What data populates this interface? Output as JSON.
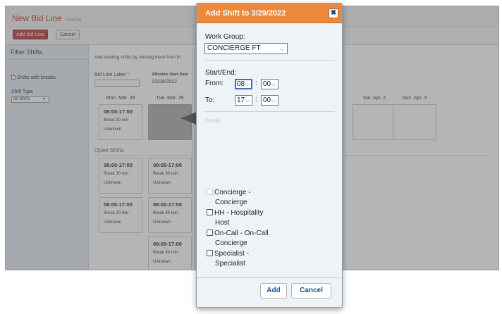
{
  "app": {
    "title": "New Bid Line",
    "subtitle": "Test RS",
    "add_bid_line_label": "Add Bid Line",
    "cancel_label": "Cancel"
  },
  "sidebar": {
    "title": "Filter Shifts",
    "shifts_with_breaks_label": "Shifts with breaks",
    "shift_type_label": "Shift Type",
    "shift_type_value": "All Shifts"
  },
  "main": {
    "intro": "Add existing shifts by clicking them from th",
    "bid_line_label": "Bid Line Label",
    "required_mark": "*",
    "effective_start_label": "Effective Start Date",
    "effective_start_value": "03/28/2022",
    "days": [
      "Mon. Mar. 28",
      "Tue. Mar. 29",
      "Sat. Apr. 2",
      "Sun. Apr. 3"
    ],
    "assigned_card": {
      "time": "08:00-17:00",
      "break": "Break 30 min",
      "status": "Unknown"
    },
    "open_shifts_title": "Open Shifts",
    "open_shifts": [
      {
        "time": "08:00-17:00",
        "break": "Break 30 min",
        "status": "Unknown"
      },
      {
        "time": "08:00-17:00",
        "break": "Break 30 min",
        "status": "Unknown"
      },
      {
        "time": "08:00-17:00",
        "break": "Break 30 min",
        "status": "Unknown"
      },
      {
        "time": "08:00-17:00",
        "break": "Break 30 min",
        "status": "Unknown"
      },
      {
        "time": "08:00-17:00",
        "break": "Break 30 min",
        "status": "Unknown"
      }
    ]
  },
  "dialog": {
    "title": "Add Shift to 3/29/2022",
    "close_glyph": "✖",
    "work_group_label": "Work Group:",
    "work_group_value": "CONCIERGE FT",
    "start_end_label": "Start/End:",
    "from_label": "From:",
    "from_hour": "08",
    "from_minute": "00",
    "to_label": "To:",
    "to_hour": "17",
    "to_minute": "00",
    "colon": ":",
    "break_label": "Break:",
    "roles": [
      {
        "line1": "Concierge -",
        "line2": "Concierge",
        "disabled": true
      },
      {
        "line1": "HH - Hospitality",
        "line2": "Host",
        "disabled": false
      },
      {
        "line1": "On-Call - On-Call",
        "line2": "Concierge",
        "disabled": false
      },
      {
        "line1": "Specialist -",
        "line2": "Specialist",
        "disabled": false
      }
    ],
    "add_label": "Add",
    "cancel_label": "Cancel"
  },
  "colors": {
    "header_orange": "#f0883a",
    "brand_red": "#b23a3a",
    "link_blue": "#1f4f93"
  }
}
